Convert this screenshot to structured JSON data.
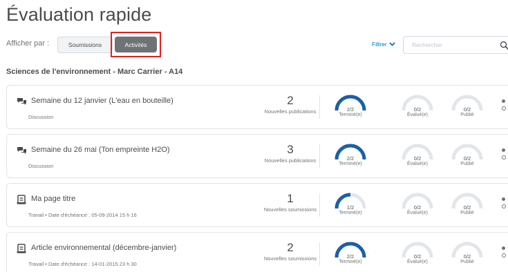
{
  "page": {
    "title": "Évaluation rapide"
  },
  "toolbar": {
    "view_by_label": "Afficher par :",
    "submissions_label": "Soumissions",
    "activities_label": "Activités",
    "filter_label": "Filtrer",
    "search_placeholder": "Rechercher"
  },
  "course_title": "Sciences de l'environnement - Marc Carrier - A14",
  "cards": [
    {
      "title": "Semaine du 12 janvier (L'eau en bouteille)",
      "subtitle": "Discussion",
      "icon": "discussion-icon",
      "count": "2",
      "count_label": "Nouvelles publications",
      "completed": {
        "value": "2/2",
        "label": "Terminé(e)",
        "fraction": 1.0
      },
      "evaluated": {
        "value": "0/2",
        "label": "Évalué(e)",
        "fraction": 0
      },
      "published": {
        "value": "0/2",
        "label": "Publié",
        "fraction": 0
      }
    },
    {
      "title": "Semaine du 26 mai (Ton empreinte H2O)",
      "subtitle": "Discussion",
      "icon": "discussion-icon",
      "count": "3",
      "count_label": "Nouvelles publications",
      "completed": {
        "value": "2/2",
        "label": "Terminé(e)",
        "fraction": 1.0
      },
      "evaluated": {
        "value": "0/2",
        "label": "Évalué(e)",
        "fraction": 0
      },
      "published": {
        "value": "0/2",
        "label": "Publié",
        "fraction": 0
      }
    },
    {
      "title": "Ma page titre",
      "subtitle": "Travail • Date d'échéance : 05-09-2014 15 h 16",
      "icon": "assignment-icon",
      "count": "1",
      "count_label": "Nouvelles soumissions",
      "completed": {
        "value": "1/2",
        "label": "Terminé(e)",
        "fraction": 0.5
      },
      "evaluated": {
        "value": "0/2",
        "label": "Évalué(e)",
        "fraction": 0
      },
      "published": {
        "value": "0/2",
        "label": "Publié",
        "fraction": 0
      }
    },
    {
      "title": "Article environnemental (décembre-janvier)",
      "subtitle": "Travail • Date d'échéance : 14-01-2015 23 h 30",
      "icon": "assignment-icon",
      "count": "2",
      "count_label": "Nouvelles soumissions",
      "completed": {
        "value": "2/2",
        "label": "Terminé(e)",
        "fraction": 1.0
      },
      "evaluated": {
        "value": "0/2",
        "label": "Évalué(e)",
        "fraction": 0
      },
      "published": {
        "value": "0/2",
        "label": "Publié",
        "fraction": 0
      }
    }
  ],
  "colors": {
    "accent": "#006fbf",
    "gauge_fill": "#1c5fa8",
    "gauge_track": "#e3e6e9",
    "active_tab": "#6e7376",
    "highlight": "#e02020"
  }
}
